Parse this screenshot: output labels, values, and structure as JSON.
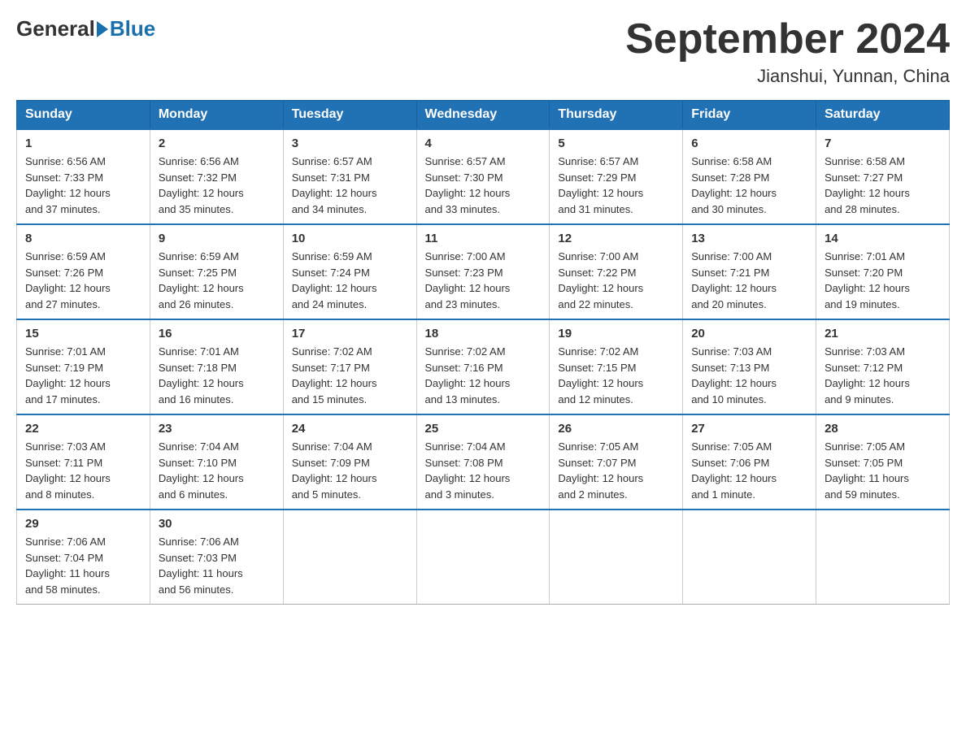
{
  "header": {
    "logo_general": "General",
    "logo_blue": "Blue",
    "month_title": "September 2024",
    "location": "Jianshui, Yunnan, China"
  },
  "weekdays": [
    "Sunday",
    "Monday",
    "Tuesday",
    "Wednesday",
    "Thursday",
    "Friday",
    "Saturday"
  ],
  "weeks": [
    [
      {
        "day": "1",
        "sunrise": "6:56 AM",
        "sunset": "7:33 PM",
        "daylight": "12 hours and 37 minutes."
      },
      {
        "day": "2",
        "sunrise": "6:56 AM",
        "sunset": "7:32 PM",
        "daylight": "12 hours and 35 minutes."
      },
      {
        "day": "3",
        "sunrise": "6:57 AM",
        "sunset": "7:31 PM",
        "daylight": "12 hours and 34 minutes."
      },
      {
        "day": "4",
        "sunrise": "6:57 AM",
        "sunset": "7:30 PM",
        "daylight": "12 hours and 33 minutes."
      },
      {
        "day": "5",
        "sunrise": "6:57 AM",
        "sunset": "7:29 PM",
        "daylight": "12 hours and 31 minutes."
      },
      {
        "day": "6",
        "sunrise": "6:58 AM",
        "sunset": "7:28 PM",
        "daylight": "12 hours and 30 minutes."
      },
      {
        "day": "7",
        "sunrise": "6:58 AM",
        "sunset": "7:27 PM",
        "daylight": "12 hours and 28 minutes."
      }
    ],
    [
      {
        "day": "8",
        "sunrise": "6:59 AM",
        "sunset": "7:26 PM",
        "daylight": "12 hours and 27 minutes."
      },
      {
        "day": "9",
        "sunrise": "6:59 AM",
        "sunset": "7:25 PM",
        "daylight": "12 hours and 26 minutes."
      },
      {
        "day": "10",
        "sunrise": "6:59 AM",
        "sunset": "7:24 PM",
        "daylight": "12 hours and 24 minutes."
      },
      {
        "day": "11",
        "sunrise": "7:00 AM",
        "sunset": "7:23 PM",
        "daylight": "12 hours and 23 minutes."
      },
      {
        "day": "12",
        "sunrise": "7:00 AM",
        "sunset": "7:22 PM",
        "daylight": "12 hours and 22 minutes."
      },
      {
        "day": "13",
        "sunrise": "7:00 AM",
        "sunset": "7:21 PM",
        "daylight": "12 hours and 20 minutes."
      },
      {
        "day": "14",
        "sunrise": "7:01 AM",
        "sunset": "7:20 PM",
        "daylight": "12 hours and 19 minutes."
      }
    ],
    [
      {
        "day": "15",
        "sunrise": "7:01 AM",
        "sunset": "7:19 PM",
        "daylight": "12 hours and 17 minutes."
      },
      {
        "day": "16",
        "sunrise": "7:01 AM",
        "sunset": "7:18 PM",
        "daylight": "12 hours and 16 minutes."
      },
      {
        "day": "17",
        "sunrise": "7:02 AM",
        "sunset": "7:17 PM",
        "daylight": "12 hours and 15 minutes."
      },
      {
        "day": "18",
        "sunrise": "7:02 AM",
        "sunset": "7:16 PM",
        "daylight": "12 hours and 13 minutes."
      },
      {
        "day": "19",
        "sunrise": "7:02 AM",
        "sunset": "7:15 PM",
        "daylight": "12 hours and 12 minutes."
      },
      {
        "day": "20",
        "sunrise": "7:03 AM",
        "sunset": "7:13 PM",
        "daylight": "12 hours and 10 minutes."
      },
      {
        "day": "21",
        "sunrise": "7:03 AM",
        "sunset": "7:12 PM",
        "daylight": "12 hours and 9 minutes."
      }
    ],
    [
      {
        "day": "22",
        "sunrise": "7:03 AM",
        "sunset": "7:11 PM",
        "daylight": "12 hours and 8 minutes."
      },
      {
        "day": "23",
        "sunrise": "7:04 AM",
        "sunset": "7:10 PM",
        "daylight": "12 hours and 6 minutes."
      },
      {
        "day": "24",
        "sunrise": "7:04 AM",
        "sunset": "7:09 PM",
        "daylight": "12 hours and 5 minutes."
      },
      {
        "day": "25",
        "sunrise": "7:04 AM",
        "sunset": "7:08 PM",
        "daylight": "12 hours and 3 minutes."
      },
      {
        "day": "26",
        "sunrise": "7:05 AM",
        "sunset": "7:07 PM",
        "daylight": "12 hours and 2 minutes."
      },
      {
        "day": "27",
        "sunrise": "7:05 AM",
        "sunset": "7:06 PM",
        "daylight": "12 hours and 1 minute."
      },
      {
        "day": "28",
        "sunrise": "7:05 AM",
        "sunset": "7:05 PM",
        "daylight": "11 hours and 59 minutes."
      }
    ],
    [
      {
        "day": "29",
        "sunrise": "7:06 AM",
        "sunset": "7:04 PM",
        "daylight": "11 hours and 58 minutes."
      },
      {
        "day": "30",
        "sunrise": "7:06 AM",
        "sunset": "7:03 PM",
        "daylight": "11 hours and 56 minutes."
      },
      null,
      null,
      null,
      null,
      null
    ]
  ],
  "labels": {
    "sunrise": "Sunrise:",
    "sunset": "Sunset:",
    "daylight": "Daylight:"
  }
}
